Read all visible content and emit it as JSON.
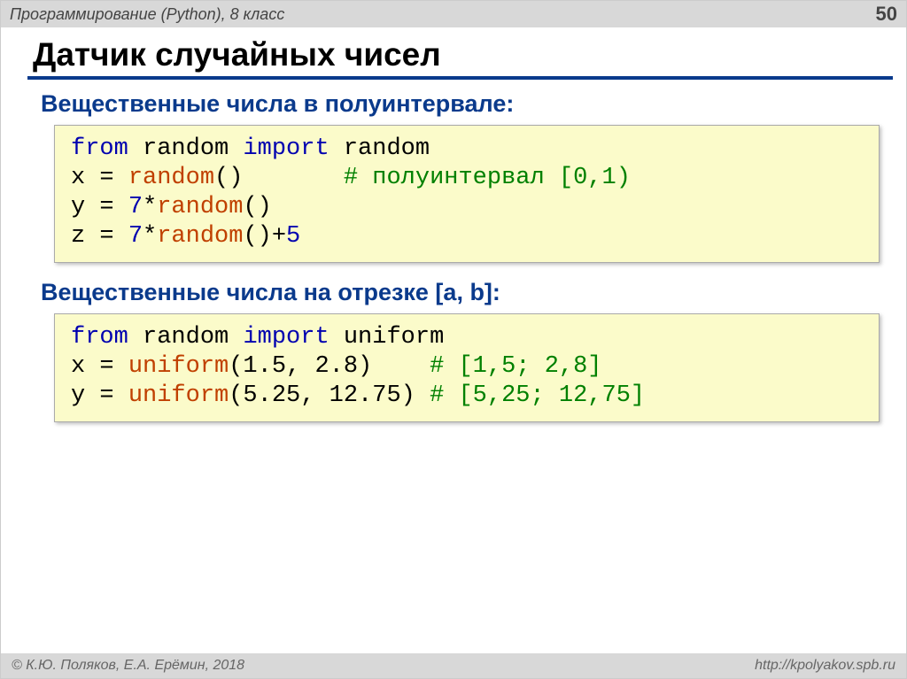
{
  "header": {
    "course": "Программирование (Python), 8 класс",
    "page_number": "50"
  },
  "title": "Датчик случайных чисел",
  "section1": {
    "heading": "Вещественные числа в полуинтервале:",
    "code": {
      "l1": {
        "kw1": "from",
        "mod": "random",
        "kw2": "import",
        "name": "random"
      },
      "l2": {
        "var": "x",
        "eq": " = ",
        "fn": "random",
        "paren": "()",
        "pad": "       ",
        "cmt": "# полуинтервал [0,1)"
      },
      "l3": {
        "var": "y",
        "eq": " = ",
        "n": "7",
        "star": "*",
        "fn": "random",
        "paren": "()"
      },
      "l4": {
        "var": "z",
        "eq": " = ",
        "n": "7",
        "star": "*",
        "fn": "random",
        "paren": "()",
        "plus": "+",
        "n2": "5"
      }
    }
  },
  "section2": {
    "heading": "Вещественные числа на отрезке [a, b]:",
    "code": {
      "l1": {
        "kw1": "from",
        "mod": "random",
        "kw2": "import",
        "name": "uniform"
      },
      "l2": {
        "var": "x",
        "eq": " = ",
        "fn": "uniform",
        "args": "(1.5, 2.8)",
        "pad": "    ",
        "cmt": "# [1,5; 2,8]"
      },
      "l3": {
        "var": "y",
        "eq": " = ",
        "fn": "uniform",
        "args": "(5.25, 12.75)",
        "pad": " ",
        "cmt": "# [5,25; 12,75]"
      }
    }
  },
  "footer": {
    "copyright": "© К.Ю. Поляков, Е.А. Ерёмин, 2018",
    "url": "http://kpolyakov.spb.ru"
  }
}
